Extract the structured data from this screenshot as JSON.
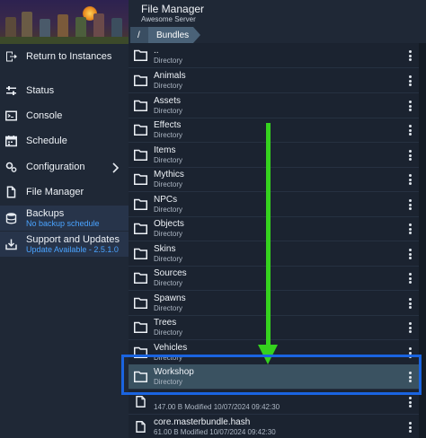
{
  "header": {
    "title": "File Manager",
    "subtitle": "Awesome Server"
  },
  "breadcrumb": {
    "root": "/",
    "current": "Bundles"
  },
  "sidebar": {
    "return_label": "Return to Instances",
    "items": [
      {
        "label": "Status",
        "icon": "sliders-icon"
      },
      {
        "label": "Console",
        "icon": "terminal-icon"
      },
      {
        "label": "Schedule",
        "icon": "calendar-icon"
      },
      {
        "label": "Configuration",
        "icon": "gears-icon"
      },
      {
        "label": "File Manager",
        "icon": "file-icon"
      }
    ],
    "backups": {
      "label": "Backups",
      "sub": "No backup schedule"
    },
    "support": {
      "label": "Support and Updates",
      "sub": "Update Available - 2.5.1.0"
    }
  },
  "files": [
    {
      "name": "..",
      "meta": "Directory",
      "type": "folder"
    },
    {
      "name": "Animals",
      "meta": "Directory",
      "type": "folder"
    },
    {
      "name": "Assets",
      "meta": "Directory",
      "type": "folder"
    },
    {
      "name": "Effects",
      "meta": "Directory",
      "type": "folder"
    },
    {
      "name": "Items",
      "meta": "Directory",
      "type": "folder"
    },
    {
      "name": "Mythics",
      "meta": "Directory",
      "type": "folder"
    },
    {
      "name": "NPCs",
      "meta": "Directory",
      "type": "folder"
    },
    {
      "name": "Objects",
      "meta": "Directory",
      "type": "folder"
    },
    {
      "name": "Skins",
      "meta": "Directory",
      "type": "folder"
    },
    {
      "name": "Sources",
      "meta": "Directory",
      "type": "folder"
    },
    {
      "name": "Spawns",
      "meta": "Directory",
      "type": "folder"
    },
    {
      "name": "Trees",
      "meta": "Directory",
      "type": "folder"
    },
    {
      "name": "Vehicles",
      "meta": "Directory",
      "type": "folder"
    },
    {
      "name": "Workshop",
      "meta": "Directory",
      "type": "folder",
      "selected": true
    },
    {
      "name": "",
      "meta": "147.00 B Modified 10/07/2024 09:42:30",
      "type": "file"
    },
    {
      "name": "core.masterbundle.hash",
      "meta": "61.00 B Modified 10/07/2024 09:42:30",
      "type": "file"
    }
  ],
  "colors": {
    "accent_blue": "#1a64e0",
    "arrow_green": "#35d21e",
    "link_blue": "#4aa3ff"
  }
}
